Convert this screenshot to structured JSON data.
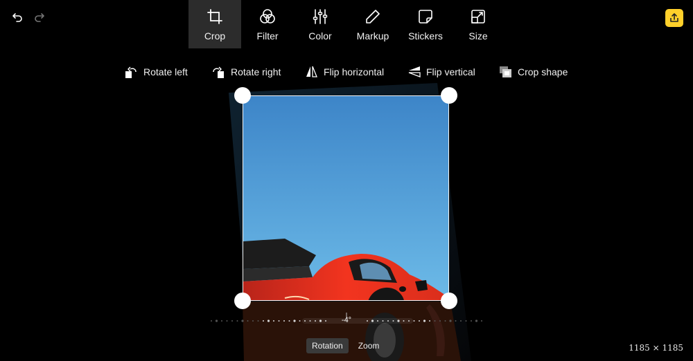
{
  "history": {
    "undo_icon": "undo-icon",
    "redo_icon": "redo-icon"
  },
  "tabs": [
    {
      "label": "Crop",
      "icon": "crop-icon",
      "active": true
    },
    {
      "label": "Filter",
      "icon": "filter-icon",
      "active": false
    },
    {
      "label": "Color",
      "icon": "sliders-icon",
      "active": false
    },
    {
      "label": "Markup",
      "icon": "pencil-icon",
      "active": false
    },
    {
      "label": "Stickers",
      "icon": "sticker-icon",
      "active": false
    },
    {
      "label": "Size",
      "icon": "resize-icon",
      "active": false
    }
  ],
  "export": {
    "icon": "export-icon",
    "color": "#ffd02b"
  },
  "subtools": [
    {
      "label": "Rotate left",
      "icon": "rotate-left-icon"
    },
    {
      "label": "Rotate right",
      "icon": "rotate-right-icon"
    },
    {
      "label": "Flip horizontal",
      "icon": "flip-horizontal-icon"
    },
    {
      "label": "Flip vertical",
      "icon": "flip-vertical-icon"
    },
    {
      "label": "Crop shape",
      "icon": "crop-shape-icon"
    }
  ],
  "rotation": {
    "value_label": "-4°",
    "degrees": -4
  },
  "modes": [
    {
      "label": "Rotation",
      "active": true
    },
    {
      "label": "Zoom",
      "active": false
    }
  ],
  "image_size": "1185 × 1185",
  "colors": {
    "sky_top": "#3d85c8",
    "sky_bottom": "#6dbbe8",
    "car_red": "#f2341f",
    "accent": "#ffd02b"
  }
}
